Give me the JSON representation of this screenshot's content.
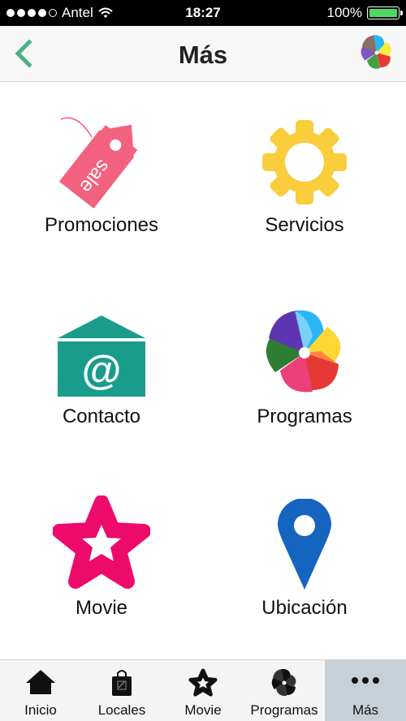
{
  "status_bar": {
    "carrier": "Antel",
    "time": "18:27",
    "battery": "100%",
    "signal_bars_filled": 4,
    "signal_bars_total": 5,
    "battery_level": 1.0
  },
  "navbar": {
    "title": "Más",
    "back_icon": "chevron-left-icon",
    "logo_icon": "pinwheel-logo-icon",
    "accent_color": "#4caf86"
  },
  "menu": {
    "items": [
      {
        "label": "Promociones",
        "icon": "sale-tag-icon",
        "color": "#f2627e"
      },
      {
        "label": "Servicios",
        "icon": "gear-icon",
        "color": "#f9cd3c"
      },
      {
        "label": "Contacto",
        "icon": "envelope-at-icon",
        "color": "#1a9c8c"
      },
      {
        "label": "Programas",
        "icon": "pinwheel-icon",
        "color": "#e84c3d"
      },
      {
        "label": "Movie",
        "icon": "star-icon",
        "color": "#ee0a6a"
      },
      {
        "label": "Ubicación",
        "icon": "map-pin-icon",
        "color": "#1565c0"
      }
    ],
    "sale_text": "sale",
    "at_symbol": "@"
  },
  "tabbar": {
    "tabs": [
      {
        "label": "Inicio",
        "icon": "home-icon"
      },
      {
        "label": "Locales",
        "icon": "shopping-bag-icon"
      },
      {
        "label": "Movie",
        "icon": "star-outline-icon"
      },
      {
        "label": "Programas",
        "icon": "pinwheel-icon"
      },
      {
        "label": "Más",
        "icon": "more-dots-icon",
        "active": true
      }
    ],
    "active_color": "#c7d0d6"
  }
}
